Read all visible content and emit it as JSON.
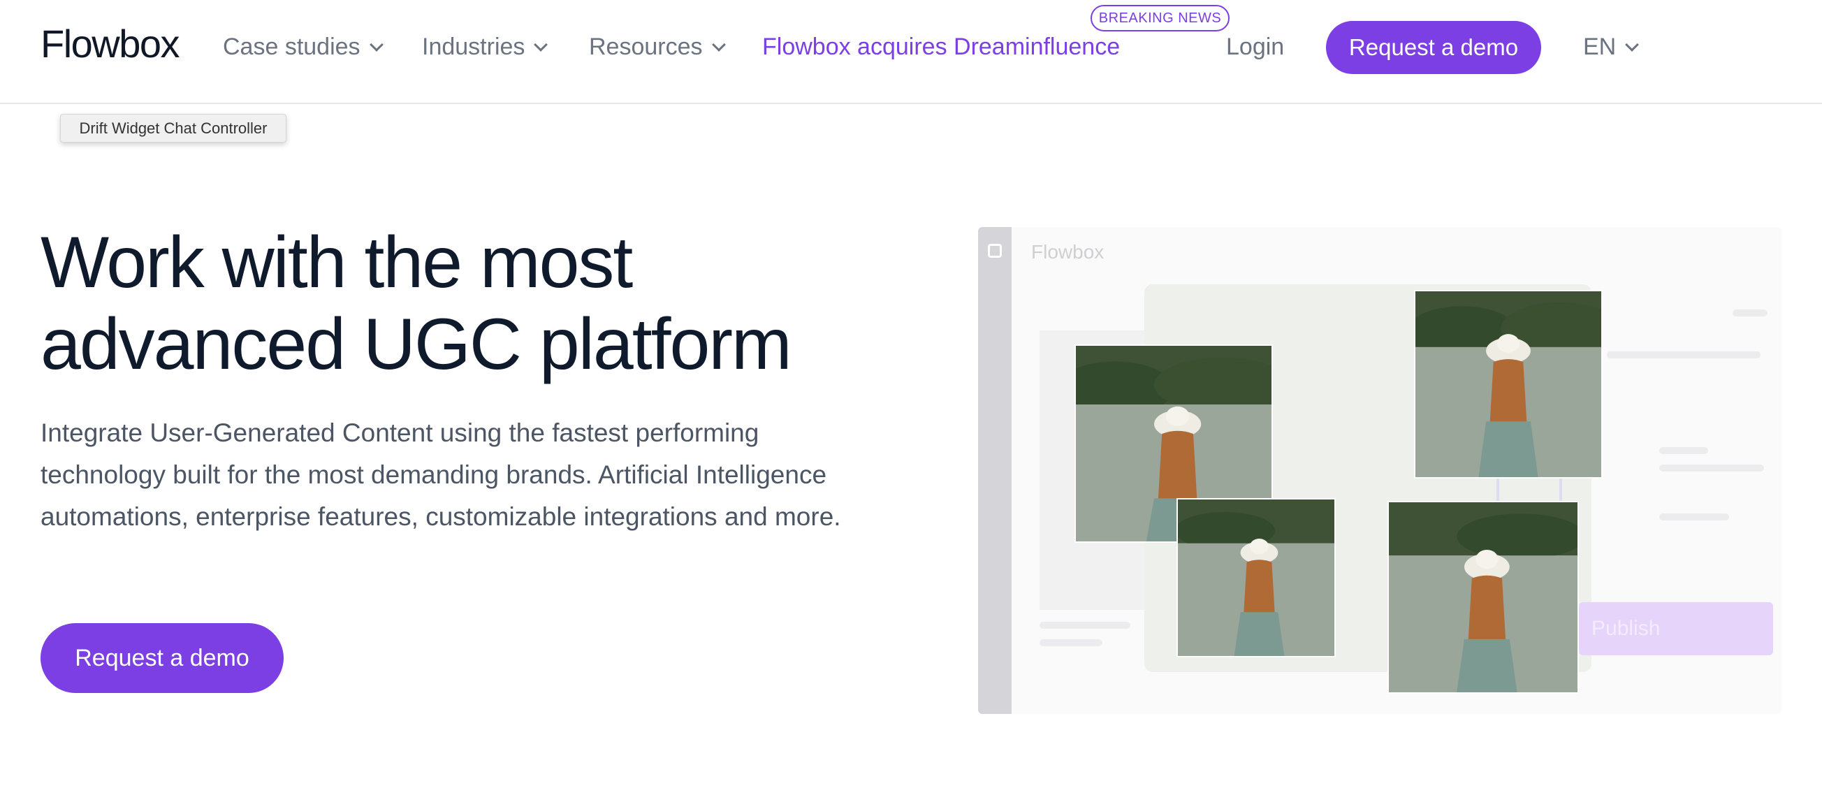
{
  "header": {
    "logo": "Flowbox",
    "nav": [
      {
        "label": "Case studies"
      },
      {
        "label": "Industries"
      },
      {
        "label": "Resources"
      }
    ],
    "news_link": "Flowbox acquires Dreaminfluence",
    "news_badge": "BREAKING NEWS",
    "login": "Login",
    "cta": "Request a demo",
    "language": "EN"
  },
  "tooltip": "Drift Widget Chat Controller",
  "hero": {
    "title_line1": "Work with the most",
    "title_line2": "advanced UGC platform",
    "description": "Integrate User-Generated Content using the fastest performing technology built for the most demanding brands. Artificial Intelligence automations, enterprise features, customizable integrations and more.",
    "cta": "Request a demo"
  },
  "mockup": {
    "brand": "Flowbox",
    "publish_label": "Publish"
  },
  "colors": {
    "accent": "#7b3fe4",
    "heading": "#0f1b2d",
    "body_text": "#4b5563",
    "nav_text": "#6b7280"
  }
}
